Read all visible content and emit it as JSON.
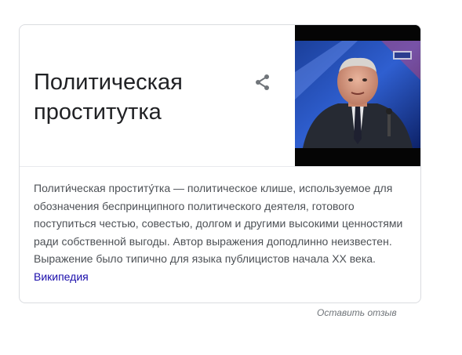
{
  "card": {
    "title": "Политическая проститутка",
    "share_icon": "share-icon",
    "image_alt": "photo-thumbnail",
    "description": {
      "text": "Полити́ческая проститу́тка — политическое клише, используемое для обозначения беспринципного политического деятеля, готового поступиться честью, совестью, долгом и другими высокими ценностями ради собственной выгоды. Автор выражения доподлинно неизвестен. Выражение было типично для языка публицистов начала XX века.",
      "source_link": "Википедия"
    }
  },
  "footer": {
    "feedback_label": "Оставить отзыв"
  },
  "colors": {
    "title": "#202124",
    "body_text": "#4d5156",
    "link": "#1a0dab",
    "border": "#dadce0",
    "muted": "#70757a"
  }
}
